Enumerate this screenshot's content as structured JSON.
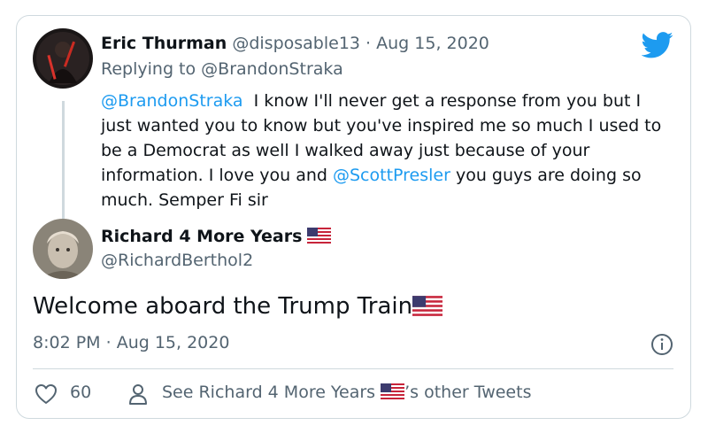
{
  "parent": {
    "author_name": "Eric Thurman",
    "handle": "@disposable13",
    "separator": "·",
    "date": "Aug 15, 2020",
    "replying_prefix": "Replying to",
    "replying_to": "@BrandonStraka",
    "text_mention_1": "@BrandonStraka",
    "text_part_1": "  I know I'll never get a response from you but I just wanted you to know but you've inspired me so much I used to be a Democrat as well I walked away just because of your information. I love you and ",
    "text_mention_2": "@ScottPresler",
    "text_part_2": " you guys are doing so much. Semper Fi sir"
  },
  "tweet": {
    "author_name": "Richard 4 More Years",
    "handle": "@RichardBerthol2",
    "text": "Welcome aboard the Trump Train",
    "time": "8:02 PM",
    "separator": "·",
    "date": "Aug 15, 2020"
  },
  "footer": {
    "like_count": "60",
    "see_prefix": "See Richard 4 More Years",
    "see_suffix": "’s other Tweets"
  },
  "icons": {
    "logo": "twitter-bird-icon",
    "info": "info-icon",
    "like": "heart-icon",
    "profile": "person-icon",
    "flag": "us-flag-icon"
  },
  "colors": {
    "link": "#1d9bf0",
    "muted": "#536471",
    "border": "#cfd9de",
    "text": "#0f1419"
  }
}
